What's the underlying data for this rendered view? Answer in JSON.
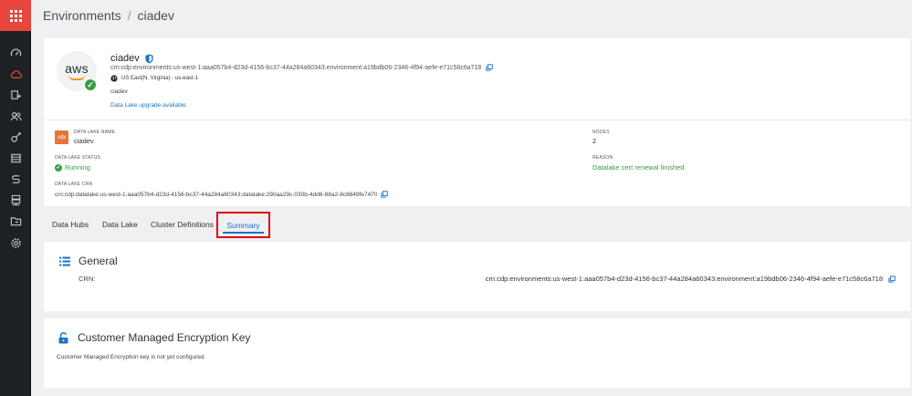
{
  "breadcrumb": {
    "root": "Environments",
    "current": "ciadev"
  },
  "environment": {
    "logo_text": "aws",
    "name": "ciadev",
    "crn": "crn:cdp:environments:us-west-1:aaa057b4-d23d-4156-bc37-44a284a60343:environment:a19bdb06-2346-4f94-aefe-e71c58c6a718",
    "region": "US East(N. Virginia) - us-east-1",
    "description": "ciadev",
    "upgrade_link": "Data Lake upgrade available"
  },
  "datalake": {
    "badge": "sdx",
    "name_label": "DATA LAKE NAME",
    "name": "ciadev",
    "nodes_label": "NODES",
    "nodes": "2",
    "status_label": "DATA LAKE STATUS",
    "status": "Running",
    "reason_label": "REASON",
    "reason": "Datalake cert renewal finished",
    "crn_label": "DATA LAKE CRN",
    "crn": "crn:cdp:datalake:us-west-1:aaa057b4-d23d-4156-bc37-44a284a60343:datalake:290aa29c-030b-4dd6-88a2-8c8849fe7470"
  },
  "tabs": [
    "Data Hubs",
    "Data Lake",
    "Cluster Definitions",
    "Summary"
  ],
  "general": {
    "title": "General",
    "crn_label": "CRN:",
    "crn": "crn:cdp:environments:us-west-1:aaa057b4-d23d-4156-bc37-44a284a60343:environment:a19bdb06-2346-4f94-aefe-e71c58c6a718"
  },
  "cmek": {
    "title": "Customer Managed Encryption Key",
    "message": "Customer Managed Encryption key is not yet configured."
  },
  "colors": {
    "accent": "#1a73c8",
    "success": "#3a9c44",
    "highlight": "#e00012",
    "rail": "#1d2124",
    "apps": "#e8453c"
  },
  "icons": [
    "apps-grid-icon",
    "dashboard-icon",
    "cloud-icon",
    "data-transfer-icon",
    "users-icon",
    "key-icon",
    "storage-icon",
    "flow-icon",
    "server-icon",
    "folder-icon",
    "settings-icon",
    "shield-icon",
    "copy-icon",
    "globe-icon",
    "check-icon",
    "list-icon",
    "lock-icon"
  ]
}
